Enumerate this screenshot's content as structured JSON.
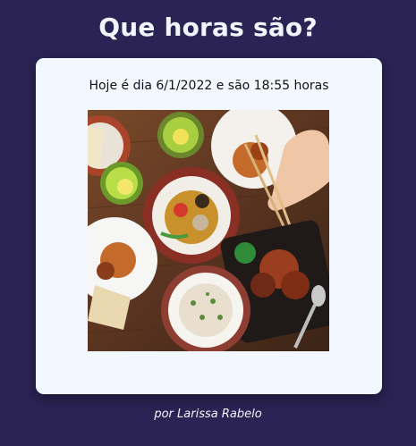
{
  "page": {
    "title": "Que horas são?",
    "message": "Hoje é dia 6/1/2022 e são 18:55 horas",
    "footer": "por Larissa Rabelo"
  },
  "image": {
    "subject": "food-photo",
    "alt": "Mesa com pratos de comida"
  },
  "colors": {
    "background": "#2b2353",
    "card": "#f2f8ff",
    "title_text": "#f1f4fb"
  }
}
